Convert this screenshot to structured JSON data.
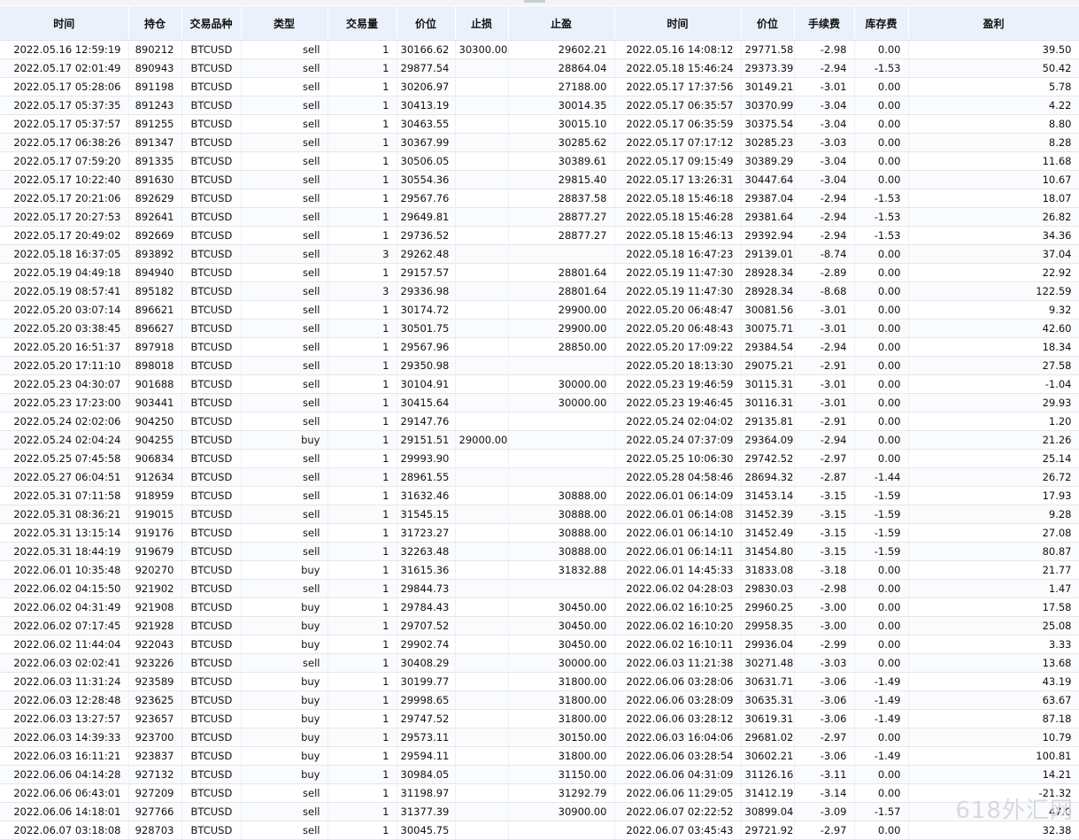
{
  "watermark": "618外汇网",
  "headers": [
    "时间",
    "持仓",
    "交易品种",
    "类型",
    "交易量",
    "价位",
    "止损",
    "止盈",
    "时间",
    "价位",
    "手续费",
    "库存费",
    "盈利"
  ],
  "rows": [
    [
      "2022.05.16 12:59:19",
      "890212",
      "BTCUSD",
      "sell",
      "1",
      "30166.62",
      "30300.00",
      "29602.21",
      "2022.05.16 14:08:12",
      "29771.58",
      "-2.98",
      "0.00",
      "39.50"
    ],
    [
      "2022.05.17 02:01:49",
      "890943",
      "BTCUSD",
      "sell",
      "1",
      "29877.54",
      "",
      "28864.04",
      "2022.05.18 15:46:24",
      "29373.39",
      "-2.94",
      "-1.53",
      "50.42"
    ],
    [
      "2022.05.17 05:28:06",
      "891198",
      "BTCUSD",
      "sell",
      "1",
      "30206.97",
      "",
      "27188.00",
      "2022.05.17 17:37:56",
      "30149.21",
      "-3.01",
      "0.00",
      "5.78"
    ],
    [
      "2022.05.17 05:37:35",
      "891243",
      "BTCUSD",
      "sell",
      "1",
      "30413.19",
      "",
      "30014.35",
      "2022.05.17 06:35:57",
      "30370.99",
      "-3.04",
      "0.00",
      "4.22"
    ],
    [
      "2022.05.17 05:37:57",
      "891255",
      "BTCUSD",
      "sell",
      "1",
      "30463.55",
      "",
      "30015.10",
      "2022.05.17 06:35:59",
      "30375.54",
      "-3.04",
      "0.00",
      "8.80"
    ],
    [
      "2022.05.17 06:38:26",
      "891347",
      "BTCUSD",
      "sell",
      "1",
      "30367.99",
      "",
      "30285.62",
      "2022.05.17 07:17:12",
      "30285.23",
      "-3.03",
      "0.00",
      "8.28"
    ],
    [
      "2022.05.17 07:59:20",
      "891335",
      "BTCUSD",
      "sell",
      "1",
      "30506.05",
      "",
      "30389.61",
      "2022.05.17 09:15:49",
      "30389.29",
      "-3.04",
      "0.00",
      "11.68"
    ],
    [
      "2022.05.17 10:22:40",
      "891630",
      "BTCUSD",
      "sell",
      "1",
      "30554.36",
      "",
      "29815.40",
      "2022.05.17 13:26:31",
      "30447.64",
      "-3.04",
      "0.00",
      "10.67"
    ],
    [
      "2022.05.17 20:21:06",
      "892629",
      "BTCUSD",
      "sell",
      "1",
      "29567.76",
      "",
      "28837.58",
      "2022.05.18 15:46:18",
      "29387.04",
      "-2.94",
      "-1.53",
      "18.07"
    ],
    [
      "2022.05.17 20:27:53",
      "892641",
      "BTCUSD",
      "sell",
      "1",
      "29649.81",
      "",
      "28877.27",
      "2022.05.18 15:46:28",
      "29381.64",
      "-2.94",
      "-1.53",
      "26.82"
    ],
    [
      "2022.05.17 20:49:02",
      "892669",
      "BTCUSD",
      "sell",
      "1",
      "29736.52",
      "",
      "28877.27",
      "2022.05.18 15:46:13",
      "29392.94",
      "-2.94",
      "-1.53",
      "34.36"
    ],
    [
      "2022.05.18 16:37:05",
      "893892",
      "BTCUSD",
      "sell",
      "3",
      "29262.48",
      "",
      "",
      "2022.05.18 16:47:23",
      "29139.01",
      "-8.74",
      "0.00",
      "37.04"
    ],
    [
      "2022.05.19 04:49:18",
      "894940",
      "BTCUSD",
      "sell",
      "1",
      "29157.57",
      "",
      "28801.64",
      "2022.05.19 11:47:30",
      "28928.34",
      "-2.89",
      "0.00",
      "22.92"
    ],
    [
      "2022.05.19 08:57:41",
      "895182",
      "BTCUSD",
      "sell",
      "3",
      "29336.98",
      "",
      "28801.64",
      "2022.05.19 11:47:30",
      "28928.34",
      "-8.68",
      "0.00",
      "122.59"
    ],
    [
      "2022.05.20 03:07:14",
      "896621",
      "BTCUSD",
      "sell",
      "1",
      "30174.72",
      "",
      "29900.00",
      "2022.05.20 06:48:47",
      "30081.56",
      "-3.01",
      "0.00",
      "9.32"
    ],
    [
      "2022.05.20 03:38:45",
      "896627",
      "BTCUSD",
      "sell",
      "1",
      "30501.75",
      "",
      "29900.00",
      "2022.05.20 06:48:43",
      "30075.71",
      "-3.01",
      "0.00",
      "42.60"
    ],
    [
      "2022.05.20 16:51:37",
      "897918",
      "BTCUSD",
      "sell",
      "1",
      "29567.96",
      "",
      "28850.00",
      "2022.05.20 17:09:22",
      "29384.54",
      "-2.94",
      "0.00",
      "18.34"
    ],
    [
      "2022.05.20 17:11:10",
      "898018",
      "BTCUSD",
      "sell",
      "1",
      "29350.98",
      "",
      "",
      "2022.05.20 18:13:30",
      "29075.21",
      "-2.91",
      "0.00",
      "27.58"
    ],
    [
      "2022.05.23 04:30:07",
      "901688",
      "BTCUSD",
      "sell",
      "1",
      "30104.91",
      "",
      "30000.00",
      "2022.05.23 19:46:59",
      "30115.31",
      "-3.01",
      "0.00",
      "-1.04"
    ],
    [
      "2022.05.23 17:23:00",
      "903441",
      "BTCUSD",
      "sell",
      "1",
      "30415.64",
      "",
      "30000.00",
      "2022.05.23 19:46:45",
      "30116.31",
      "-3.01",
      "0.00",
      "29.93"
    ],
    [
      "2022.05.24 02:02:06",
      "904250",
      "BTCUSD",
      "sell",
      "1",
      "29147.76",
      "",
      "",
      "2022.05.24 02:04:02",
      "29135.81",
      "-2.91",
      "0.00",
      "1.20"
    ],
    [
      "2022.05.24 02:04:24",
      "904255",
      "BTCUSD",
      "buy",
      "1",
      "29151.51",
      "29000.00",
      "",
      "2022.05.24 07:37:09",
      "29364.09",
      "-2.94",
      "0.00",
      "21.26"
    ],
    [
      "2022.05.25 07:45:58",
      "906834",
      "BTCUSD",
      "sell",
      "1",
      "29993.90",
      "",
      "",
      "2022.05.25 10:06:30",
      "29742.52",
      "-2.97",
      "0.00",
      "25.14"
    ],
    [
      "2022.05.27 06:04:51",
      "912634",
      "BTCUSD",
      "sell",
      "1",
      "28961.55",
      "",
      "",
      "2022.05.28 04:58:46",
      "28694.32",
      "-2.87",
      "-1.44",
      "26.72"
    ],
    [
      "2022.05.31 07:11:58",
      "918959",
      "BTCUSD",
      "sell",
      "1",
      "31632.46",
      "",
      "30888.00",
      "2022.06.01 06:14:09",
      "31453.14",
      "-3.15",
      "-1.59",
      "17.93"
    ],
    [
      "2022.05.31 08:36:21",
      "919015",
      "BTCUSD",
      "sell",
      "1",
      "31545.15",
      "",
      "30888.00",
      "2022.06.01 06:14:08",
      "31452.39",
      "-3.15",
      "-1.59",
      "9.28"
    ],
    [
      "2022.05.31 13:15:14",
      "919176",
      "BTCUSD",
      "sell",
      "1",
      "31723.27",
      "",
      "30888.00",
      "2022.06.01 06:14:10",
      "31452.49",
      "-3.15",
      "-1.59",
      "27.08"
    ],
    [
      "2022.05.31 18:44:19",
      "919679",
      "BTCUSD",
      "sell",
      "1",
      "32263.48",
      "",
      "30888.00",
      "2022.06.01 06:14:11",
      "31454.80",
      "-3.15",
      "-1.59",
      "80.87"
    ],
    [
      "2022.06.01 10:35:48",
      "920270",
      "BTCUSD",
      "buy",
      "1",
      "31615.36",
      "",
      "31832.88",
      "2022.06.01 14:45:33",
      "31833.08",
      "-3.18",
      "0.00",
      "21.77"
    ],
    [
      "2022.06.02 04:15:50",
      "921902",
      "BTCUSD",
      "sell",
      "1",
      "29844.73",
      "",
      "",
      "2022.06.02 04:28:03",
      "29830.03",
      "-2.98",
      "0.00",
      "1.47"
    ],
    [
      "2022.06.02 04:31:49",
      "921908",
      "BTCUSD",
      "buy",
      "1",
      "29784.43",
      "",
      "30450.00",
      "2022.06.02 16:10:25",
      "29960.25",
      "-3.00",
      "0.00",
      "17.58"
    ],
    [
      "2022.06.02 07:17:45",
      "921928",
      "BTCUSD",
      "buy",
      "1",
      "29707.52",
      "",
      "30450.00",
      "2022.06.02 16:10:20",
      "29958.35",
      "-3.00",
      "0.00",
      "25.08"
    ],
    [
      "2022.06.02 11:44:04",
      "922043",
      "BTCUSD",
      "buy",
      "1",
      "29902.74",
      "",
      "30450.00",
      "2022.06.02 16:10:11",
      "29936.04",
      "-2.99",
      "0.00",
      "3.33"
    ],
    [
      "2022.06.03 02:02:41",
      "923226",
      "BTCUSD",
      "sell",
      "1",
      "30408.29",
      "",
      "30000.00",
      "2022.06.03 11:21:38",
      "30271.48",
      "-3.03",
      "0.00",
      "13.68"
    ],
    [
      "2022.06.03 11:31:24",
      "923589",
      "BTCUSD",
      "buy",
      "1",
      "30199.77",
      "",
      "31800.00",
      "2022.06.06 03:28:06",
      "30631.71",
      "-3.06",
      "-1.49",
      "43.19"
    ],
    [
      "2022.06.03 12:28:48",
      "923625",
      "BTCUSD",
      "buy",
      "1",
      "29998.65",
      "",
      "31800.00",
      "2022.06.06 03:28:09",
      "30635.31",
      "-3.06",
      "-1.49",
      "63.67"
    ],
    [
      "2022.06.03 13:27:57",
      "923657",
      "BTCUSD",
      "buy",
      "1",
      "29747.52",
      "",
      "31800.00",
      "2022.06.06 03:28:12",
      "30619.31",
      "-3.06",
      "-1.49",
      "87.18"
    ],
    [
      "2022.06.03 14:39:33",
      "923700",
      "BTCUSD",
      "buy",
      "1",
      "29573.11",
      "",
      "30150.00",
      "2022.06.03 16:04:06",
      "29681.02",
      "-2.97",
      "0.00",
      "10.79"
    ],
    [
      "2022.06.03 16:11:21",
      "923837",
      "BTCUSD",
      "buy",
      "1",
      "29594.11",
      "",
      "31800.00",
      "2022.06.06 03:28:54",
      "30602.21",
      "-3.06",
      "-1.49",
      "100.81"
    ],
    [
      "2022.06.06 04:14:28",
      "927132",
      "BTCUSD",
      "buy",
      "1",
      "30984.05",
      "",
      "31150.00",
      "2022.06.06 04:31:09",
      "31126.16",
      "-3.11",
      "0.00",
      "14.21"
    ],
    [
      "2022.06.06 06:43:01",
      "927209",
      "BTCUSD",
      "sell",
      "1",
      "31198.97",
      "",
      "31292.79",
      "2022.06.06 11:29:05",
      "31412.19",
      "-3.14",
      "0.00",
      "-21.32"
    ],
    [
      "2022.06.06 14:18:01",
      "927766",
      "BTCUSD",
      "sell",
      "1",
      "31377.39",
      "",
      "30900.00",
      "2022.06.07 02:22:52",
      "30899.04",
      "-3.09",
      "-1.57",
      "47.0"
    ],
    [
      "2022.06.07 03:18:08",
      "928703",
      "BTCUSD",
      "sell",
      "1",
      "30045.75",
      "",
      "",
      "2022.06.07 03:45:43",
      "29721.92",
      "-2.97",
      "0.00",
      "32.38"
    ]
  ]
}
